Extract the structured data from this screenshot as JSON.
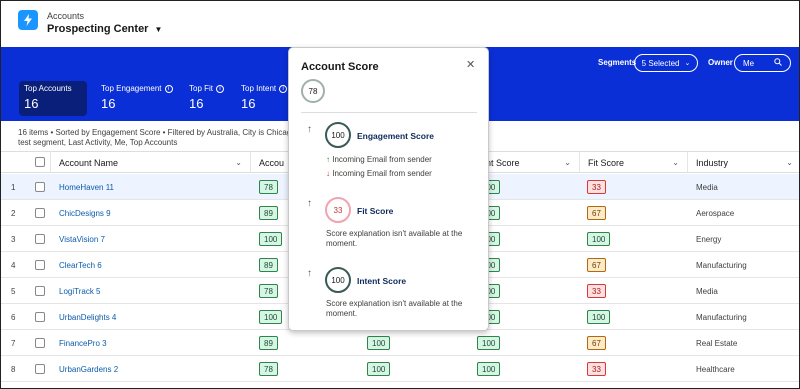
{
  "header": {
    "breadcrumb": "Accounts",
    "title": "Prospecting Center"
  },
  "toolbar": {
    "segments_label": "Segments",
    "segments_value": "5 Selected",
    "owner_label": "Owner",
    "owner_value": "Me"
  },
  "stats": [
    {
      "label": "Top Accounts",
      "value": "16"
    },
    {
      "label": "Top Engagement",
      "value": "16"
    },
    {
      "label": "Top Fit",
      "value": "16"
    },
    {
      "label": "Top Intent",
      "value": "16"
    }
  ],
  "filter_text": "16 items • Sorted by Engagement Score • Filtered by Australia, City is Chicago, test segment, Last Activity, Me, Top Accounts",
  "columns": {
    "account_name": "Account Name",
    "account_score": "Accou",
    "intent_score": "ent Score",
    "fit_score": "Fit Score",
    "industry": "Industry"
  },
  "rows": [
    {
      "n": "1",
      "name": "HomeHaven 11",
      "account": "78",
      "intent": "100",
      "fit": "33",
      "industry": "Media"
    },
    {
      "n": "2",
      "name": "ChicDesigns 9",
      "account": "89",
      "intent": "100",
      "fit": "67",
      "industry": "Aerospace"
    },
    {
      "n": "3",
      "name": "VistaVision 7",
      "account": "100",
      "intent": "100",
      "fit": "100",
      "industry": "Energy"
    },
    {
      "n": "4",
      "name": "ClearTech 6",
      "account": "89",
      "intent": "100",
      "fit": "67",
      "industry": "Manufacturing"
    },
    {
      "n": "5",
      "name": "LogiTrack 5",
      "account": "78",
      "intent": "100",
      "fit": "33",
      "industry": "Media"
    },
    {
      "n": "6",
      "name": "UrbanDelights 4",
      "account": "100",
      "intent": "100",
      "fit": "100",
      "industry": "Manufacturing"
    },
    {
      "n": "7",
      "name": "FinancePro 3",
      "account": "89",
      "engagement": "100",
      "intent": "100",
      "fit": "67",
      "industry": "Real Estate"
    },
    {
      "n": "8",
      "name": "UrbanGardens 2",
      "account": "78",
      "engagement": "100",
      "intent": "100",
      "fit": "33",
      "industry": "Healthcare"
    }
  ],
  "popover": {
    "title": "Account Score",
    "overall": "78",
    "engagement": {
      "score": "100",
      "title": "Engagement Score",
      "line1": "Incoming Email from sender",
      "line2": "Incoming Email from sender"
    },
    "fit": {
      "score": "33",
      "title": "Fit Score",
      "text": "Score explanation isn't available at the moment."
    },
    "intent": {
      "score": "100",
      "title": "Intent Score",
      "text": "Score explanation isn't available at the moment."
    }
  },
  "colors": {
    "band": "#0b2fd6",
    "link": "#0b5cab",
    "green": "#2e844a",
    "red": "#d53a3a",
    "yellow": "#b0690d"
  }
}
